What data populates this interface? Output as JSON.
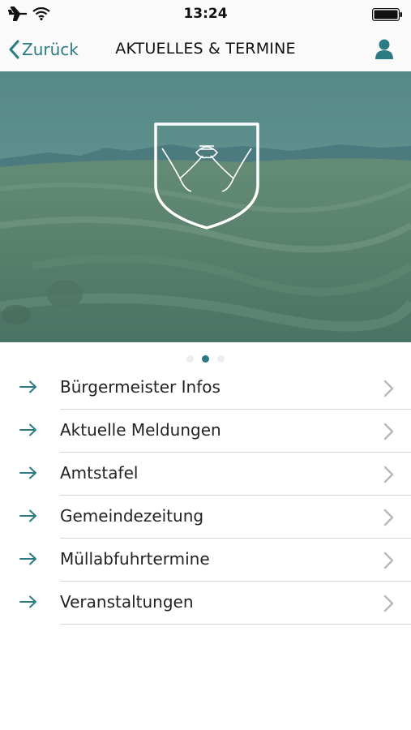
{
  "status_bar": {
    "time": "13:24"
  },
  "nav": {
    "back_label": "Zurück",
    "title": "AKTUELLES & TERMINE"
  },
  "colors": {
    "accent": "#2b7b84",
    "divider": "#d6d6d6",
    "hero_tint": "#3f7f7a"
  },
  "carousel": {
    "pages": 3,
    "active_page": 2
  },
  "menu": {
    "items": [
      {
        "label": "Bürgermeister Infos"
      },
      {
        "label": "Aktuelle Meldungen"
      },
      {
        "label": "Amtstafel"
      },
      {
        "label": "Gemeindezeitung"
      },
      {
        "label": "Müllabfuhrtermine"
      },
      {
        "label": "Veranstaltungen"
      }
    ]
  },
  "icons": {
    "airplane": "airplane-icon",
    "wifi": "wifi-icon",
    "battery": "battery-icon",
    "back": "chevron-left-icon",
    "profile": "user-icon",
    "menu_arrow": "arrow-right-icon",
    "menu_chevron": "chevron-right-icon",
    "logo": "coat-of-arms-logo"
  }
}
